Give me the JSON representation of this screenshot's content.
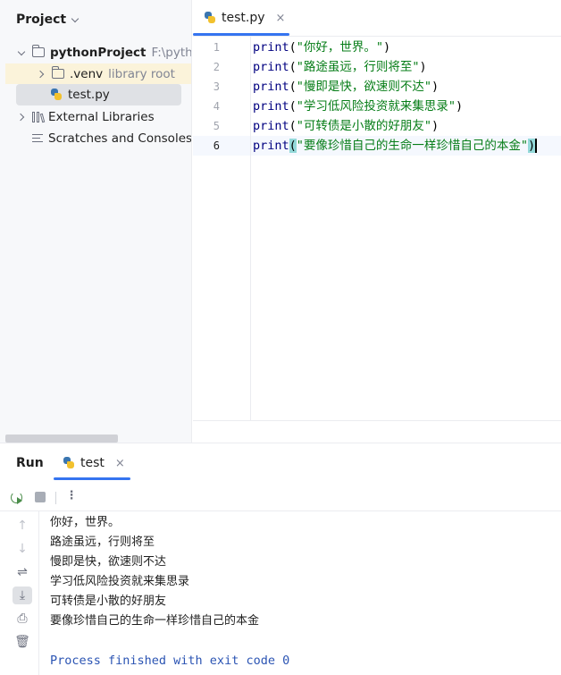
{
  "project_panel": {
    "title": "Project",
    "items": [
      {
        "label": "pythonProject",
        "hint": "F:\\pythonI"
      },
      {
        "label": ".venv",
        "hint": "library root"
      },
      {
        "label": "test.py"
      },
      {
        "label": "External Libraries"
      },
      {
        "label": "Scratches and Consoles"
      }
    ]
  },
  "editor": {
    "tab_label": "test.py",
    "close_glyph": "×",
    "lines": [
      {
        "num": "1",
        "kw": "print",
        "open": "(",
        "str": "\"你好，世界。\"",
        "close": ")"
      },
      {
        "num": "2",
        "kw": "print",
        "open": "(",
        "str": "\"路途虽远，行则将至\"",
        "close": ")"
      },
      {
        "num": "3",
        "kw": "print",
        "open": "(",
        "str": "\"慢即是快，欲速则不达\"",
        "close": ")"
      },
      {
        "num": "4",
        "kw": "print",
        "open": "(",
        "str": "\"学习低风险投资就来集思录\"",
        "close": ")"
      },
      {
        "num": "5",
        "kw": "print",
        "open": "(",
        "str": "\"可转债是小散的好朋友\"",
        "close": ")"
      },
      {
        "num": "6",
        "kw": "print",
        "open": "(",
        "str": "\"要像珍惜自己的生命一样珍惜自己的本金\"",
        "close": ")"
      }
    ]
  },
  "run_panel": {
    "title": "Run",
    "tab_label": "test",
    "close_glyph": "×",
    "more_glyph": "⋮",
    "output": [
      "你好，世界。",
      "路途虽远，行则将至",
      "慢即是快，欲速则不达",
      "学习低风险投资就来集思录",
      "可转债是小散的好朋友",
      "要像珍惜自己的生命一样珍惜自己的本金"
    ],
    "exit_message": "Process finished with exit code 0"
  },
  "side_toolbar": {
    "up": "↑",
    "down": "↓",
    "wrap": "⇌",
    "scroll_end": "⤓",
    "print": "⎙",
    "clear": "🗑"
  }
}
